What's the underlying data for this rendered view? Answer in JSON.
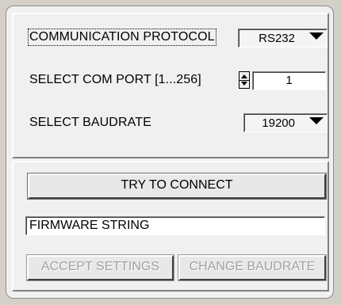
{
  "connection": {
    "protocol_label": "COMMUNICATION PROTOCOL",
    "protocol_value": "RS232",
    "com_port_label": "SELECT COM PORT [1...256]",
    "com_port_value": "1",
    "baudrate_label": "SELECT BAUDRATE",
    "baudrate_value": "19200"
  },
  "actions": {
    "connect_label": "TRY TO CONNECT",
    "firmware_text": "FIRMWARE STRING",
    "accept_label": "ACCEPT SETTINGS",
    "change_baud_label": "CHANGE BAUDRATE"
  },
  "icons": {
    "dropdown": "chevron-down-icon",
    "spinner": "spinner-arrows-icon"
  }
}
